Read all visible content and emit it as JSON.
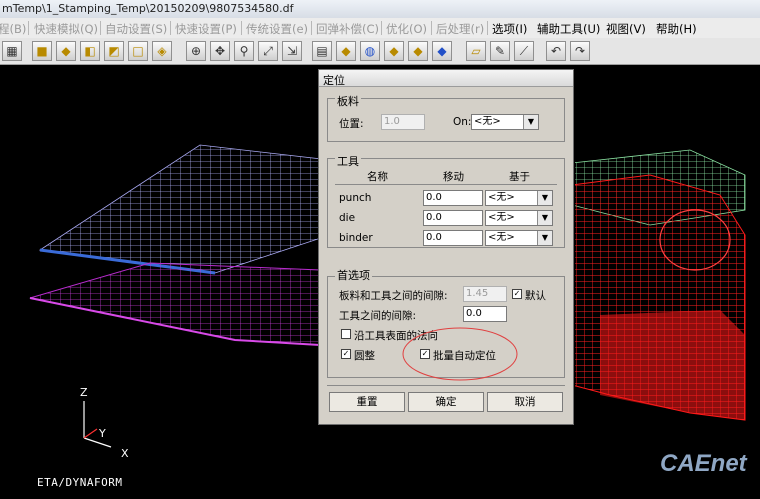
{
  "window": {
    "title": "mTemp\\1_Stamping_Temp\\20150209\\9807534580.df",
    "min_icon": "minimize-icon",
    "max_icon": "maximize-icon",
    "close_icon": "close-icon"
  },
  "menubar": {
    "items": [
      "程(B)",
      "快速模拟(Q)",
      "自动设置(S)",
      "快速设置(P)",
      "传统设置(e)",
      "回弹补偿(C)",
      "优化(O)",
      "后处理(r)",
      "选项(I)",
      "辅助工具(U)",
      "视图(V)",
      "帮助(H)"
    ]
  },
  "toolbar": {
    "icons": [
      "mesh-icon",
      "cube-front-icon",
      "cube-top-icon",
      "cube-side-icon",
      "cube-iso-icon",
      "cube-wire-icon",
      "rotate-icon",
      "pan-icon",
      "zoom-icon",
      "zoom-box-icon",
      "fit-icon",
      "calculator-icon",
      "cube-shaded-icon",
      "cube-view1-icon",
      "cube-view2-icon",
      "cube-view3-icon",
      "cube-view4-icon",
      "surface-icon",
      "brush-icon",
      "measure-icon",
      "undo-icon",
      "redo-icon"
    ]
  },
  "viewport": {
    "axis_z": "Z",
    "axis_y": "Y",
    "axis_x": "X",
    "brand": "ETA/DYNAFORM",
    "watermark": "CAEnet",
    "colors": {
      "blank_top": "#a9a9f2",
      "blank_blue": "#3a6bd8",
      "binder": "#b92ccf",
      "punch_red": "#ff1a1a",
      "die_green": "#8be3a2"
    }
  },
  "dialog": {
    "title": "定位",
    "blank": {
      "group": "板料",
      "position_label": "位置:",
      "position_value": "1.0",
      "on_label": "On:",
      "on_value": "<无>"
    },
    "tools": {
      "group": "工具",
      "col_name": "名称",
      "col_move": "移动",
      "col_base": "基于",
      "rows": [
        {
          "name": "punch",
          "move": "0.0",
          "base": "<无>"
        },
        {
          "name": "die",
          "move": "0.0",
          "base": "<无>"
        },
        {
          "name": "binder",
          "move": "0.0",
          "base": "<无>"
        }
      ]
    },
    "prefs": {
      "group": "首选项",
      "gap_label": "板料和工具之间的间隙:",
      "gap_value": "1.45",
      "default_label": "默认",
      "default_checked": "✓",
      "tool_gap_label": "工具之间的间隙:",
      "tool_gap_value": "0.0",
      "normal_label": "沿工具表面的法向",
      "normal_checked": "",
      "round_label": "圆整",
      "round_checked": "✓",
      "batch_label": "批量自动定位",
      "batch_checked": "✓"
    },
    "buttons": {
      "reset": "重置",
      "ok": "确定",
      "cancel": "取消"
    }
  }
}
